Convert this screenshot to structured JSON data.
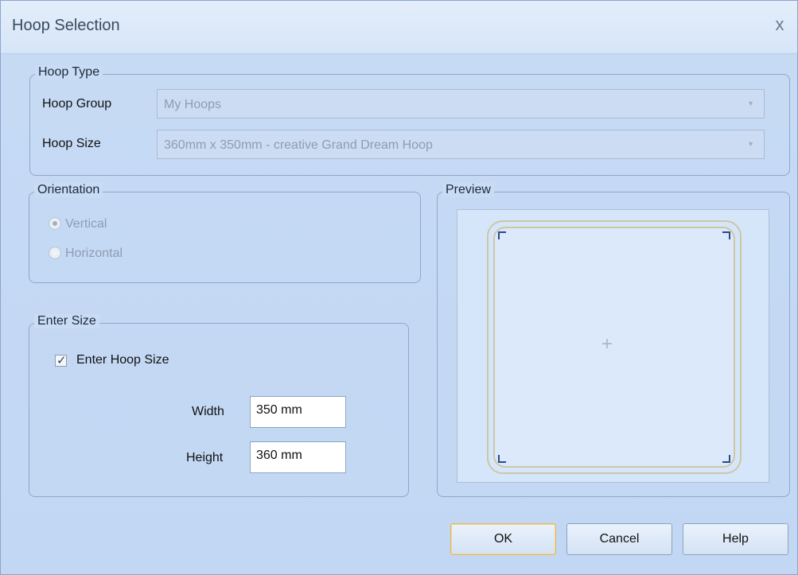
{
  "window": {
    "title": "Hoop Selection",
    "close_glyph": "x"
  },
  "hoop_type": {
    "legend": "Hoop Type",
    "group_label": "Hoop Group",
    "group_value": "My Hoops",
    "size_label": "Hoop Size",
    "size_value": "360mm x 350mm - creative Grand Dream Hoop"
  },
  "orientation": {
    "legend": "Orientation",
    "options": [
      {
        "label": "Vertical",
        "checked": true
      },
      {
        "label": "Horizontal",
        "checked": false
      }
    ]
  },
  "enter_size": {
    "legend": "Enter Size",
    "checkbox_label": "Enter Hoop Size",
    "checkbox_checked": true,
    "width_label": "Width",
    "width_value": "350 mm",
    "height_label": "Height",
    "height_value": "360 mm"
  },
  "preview": {
    "legend": "Preview"
  },
  "buttons": {
    "ok": "OK",
    "cancel": "Cancel",
    "help": "Help"
  },
  "colors": {
    "dialog_bg": "#c6daf4",
    "hoop_frame": "#cfc7a3",
    "corner_marks": "#2b4a8a",
    "default_button_border": "#e1b85a"
  },
  "icons": {
    "close": "close-icon",
    "dropdown": "chevron-down-icon",
    "checkbox": "checkmark-icon",
    "crosshair": "crosshair-icon"
  }
}
